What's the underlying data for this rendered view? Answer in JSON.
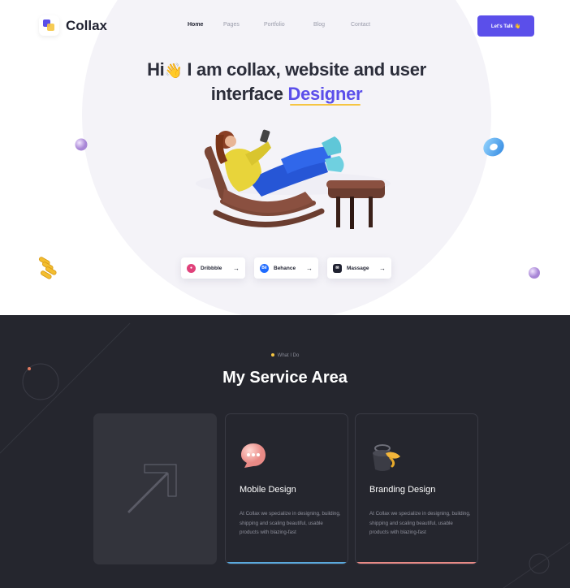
{
  "brand": {
    "name": "Collax"
  },
  "nav": {
    "items": [
      {
        "label": "Home",
        "active": true
      },
      {
        "label": "Pages",
        "active": false
      },
      {
        "label": "Portfolio",
        "active": false
      },
      {
        "label": "Blog",
        "active": false
      },
      {
        "label": "Contact",
        "active": false
      }
    ],
    "cta_label": "Let's Talk 👋"
  },
  "hero": {
    "line1_prefix": "Hi",
    "line1_emoji": "👋",
    "line1_rest": "I am collax, website and user",
    "line2_prefix": "interface",
    "line2_highlight": "Designer"
  },
  "social": [
    {
      "label": "Dribbble",
      "icon": "dribbble-icon",
      "arrow": "→",
      "color": "#e0417a"
    },
    {
      "label": "Behance",
      "icon": "behance-icon",
      "arrow": "→",
      "color": "#1f6bff"
    },
    {
      "label": "Massage",
      "icon": "message-icon",
      "arrow": "→",
      "color": "#1f2130"
    }
  ],
  "services": {
    "tagline": "What I Do",
    "title": "My Service Area",
    "cards": [
      {
        "title": "Mobile Design",
        "description": "At Collax we specialize in designing, building, shipping and scaling beautiful, usable products with blazing-fast",
        "icon": "chat-bubble-icon",
        "accent": "#5aa9dd"
      },
      {
        "title": "Branding Design",
        "description": "At Collax we specialize in designing, building, shipping and scaling beautiful, usable products with blazing-fast",
        "icon": "paint-bucket-icon",
        "accent": "#e88a86"
      }
    ]
  },
  "colors": {
    "accent": "#5b4fea",
    "highlight": "#f5c542",
    "dark_bg": "#25262e"
  }
}
